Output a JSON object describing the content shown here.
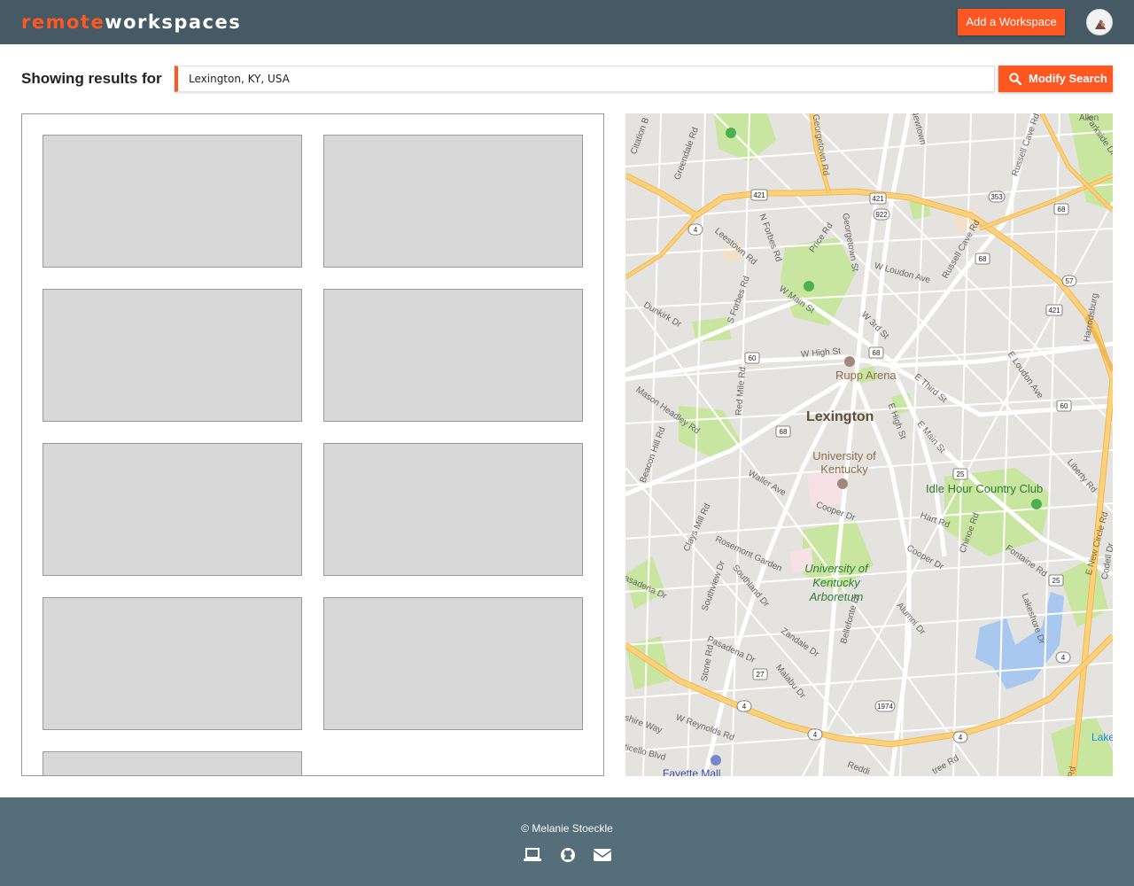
{
  "header": {
    "logo_part1": "remote",
    "logo_part2": "workspaces",
    "add_button_label": "Add a Workspace",
    "avatar_icon": "user-avatar"
  },
  "search": {
    "label": "Showing results for",
    "value": "Lexington, KY, USA",
    "button_label": "Modify Search",
    "button_icon": "search-icon"
  },
  "results": {
    "card_count": 9
  },
  "map": {
    "labels": {
      "city": "Lexington",
      "rupp": "Rupp Arena",
      "uk": "University of Kentucky",
      "idle": "Idle Hour Country Club",
      "arb": "University of Kentucky Arboretum",
      "fayette": "Fayette Mall",
      "lake": "Lake",
      "georgetown": "Georgetown Rd",
      "newtown": "Newtown",
      "russell": "Russell Cave Rd",
      "leestown": "Leestown Rd",
      "nforbes": "N Forbes Rd",
      "price": "Price Rd",
      "gtownst": "Georgetown St",
      "wloudon": "W Loudon Ave",
      "russell2": "Russell Cave Rd",
      "wmain": "W Main St",
      "sforbes": "S Forbes Rd",
      "w3rd": "W 3rd St",
      "dunkirk": "Dunkirk Dr",
      "whigh": "W High St",
      "e3rd": "E Third St",
      "eloudon": "E Loudon Ave",
      "redmile": "Red Mile Rd",
      "ehigh": "E High St",
      "mason": "Mason Headley Rd",
      "emain": "E Main St",
      "beacon": "Beacon Hill Rd",
      "waller": "Waller Ave",
      "liberty": "Liberty Rd",
      "cooper": "Cooper Dr",
      "hart": "Hart Rd",
      "chinoe": "Chinoe Rd",
      "newcircle": "E New Circle Rd",
      "clays": "Clays Mill Rd",
      "rosemont": "Rosemont Garden",
      "fontaine": "Fontaine Rd",
      "cooper2": "Cooper Dr",
      "southland": "Southland Dr",
      "southview": "Southview Dr",
      "pasadena": "Pasadena Dr",
      "bellefonte": "Bellefonte Dr",
      "alumni": "Alumni Dr",
      "lakeshore": "Lakeshore Dr",
      "zandale": "Zandale Dr",
      "pasadena2": "Pasadena Dr",
      "stone": "Stone Rd",
      "malabu": "Malabu Dr",
      "wreynolds": "W Reynolds Rd",
      "shireway": "shire Way",
      "ticello": "ticello Blvd",
      "citation": "Citation B",
      "greendale": "Greendale Rd",
      "parkside": "Parkside Dr",
      "allen": "Allen",
      "harrodsburg": "Harrodsburg",
      "redding": "Reddi",
      "tree": "tree Rd",
      "codell": "Codell Dr",
      "rd": "Rd"
    },
    "shields": [
      "421",
      "421",
      "922",
      "353",
      "68",
      "68",
      "57",
      "421",
      "4",
      "60",
      "68",
      "60",
      "68",
      "25",
      "25",
      "4",
      "27",
      "4",
      "1974",
      "4",
      "4"
    ],
    "colors": {
      "background": "#e5e3df",
      "road": "#ffffff",
      "highway": "#fdd17a",
      "highway_edge": "#f0b856",
      "park": "#c8e6a0",
      "water": "#a8c8f0",
      "campus": "#f5e1e6"
    }
  },
  "footer": {
    "copyright": "© Melanie Stoeckle",
    "icons": [
      "laptop-icon",
      "github-icon",
      "envelope-icon"
    ]
  },
  "colors": {
    "header": "#455a64",
    "accent": "#ff5722",
    "footer": "#546e7a"
  }
}
